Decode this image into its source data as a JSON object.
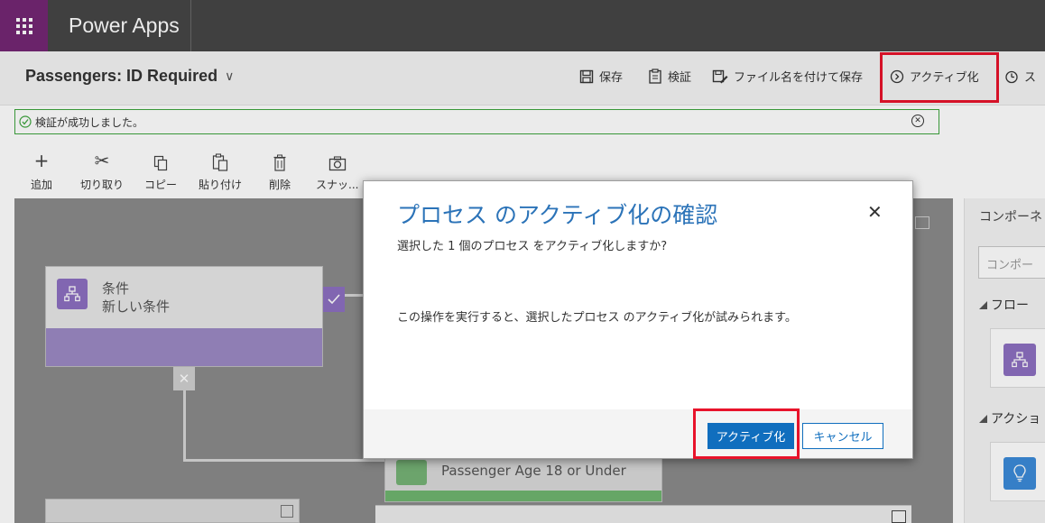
{
  "topbar": {
    "app_name": "Power Apps"
  },
  "header": {
    "flow_title": "Passengers: ID Required",
    "commands": {
      "save": "保存",
      "verify": "検証",
      "save_as": "ファイル名を付けて保存",
      "activate": "アクティブ化",
      "more": "ス"
    }
  },
  "banner": {
    "message": "検証が成功しました。"
  },
  "toolbar": {
    "add": "追加",
    "cut": "切り取り",
    "copy": "コピー",
    "paste": "貼り付け",
    "delete": "削除",
    "snapshot": "スナッ..."
  },
  "canvas": {
    "condition_node": {
      "type": "条件",
      "name": "新しい条件"
    },
    "age_node": {
      "name": "Passenger Age 18 or Under"
    }
  },
  "right_panel": {
    "title": "コンポーネ",
    "search_placeholder": "コンポー",
    "section_flow": "フロー",
    "section_action": "アクショ"
  },
  "dialog": {
    "title": "プロセス のアクティブ化の確認",
    "subtitle": "選択した 1 個のプロセス をアクティブ化しますか?",
    "message": "この操作を実行すると、選択したプロセス のアクティブ化が試みられます。",
    "activate_button": "アクティブ化",
    "cancel_button": "キャンセル"
  },
  "colors": {
    "brand_purple": "#742774",
    "primary_blue": "#106ebe",
    "highlight_red": "#e8132b",
    "success_green": "#3da43d"
  }
}
